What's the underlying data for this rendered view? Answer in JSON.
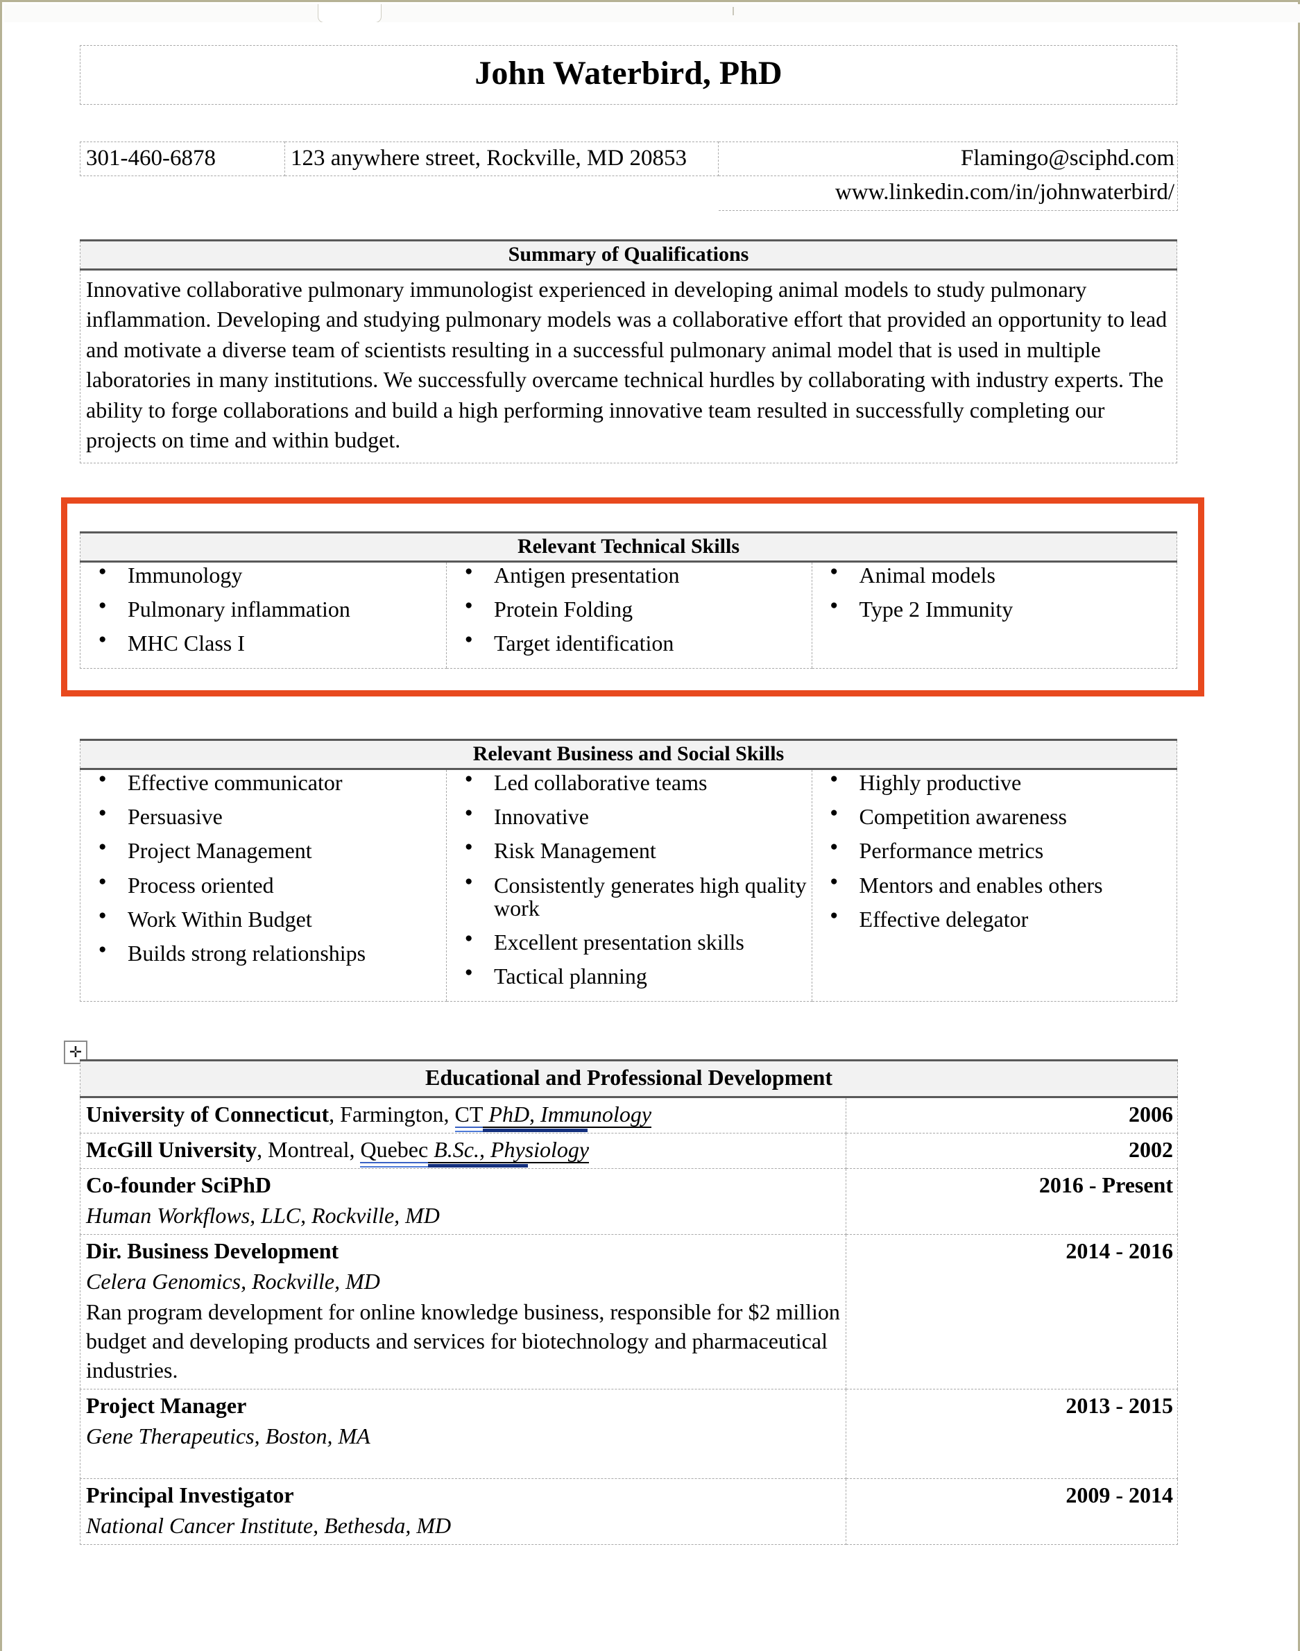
{
  "document": {
    "name": "John Waterbird, PhD"
  },
  "contact": {
    "phone": "301-460-6878",
    "address": "123 anywhere street, Rockville, MD 20853",
    "email": "Flamingo@sciphd.com",
    "linkedin": "www.linkedin.com/in/johnwaterbird/"
  },
  "summary": {
    "heading": "Summary of Qualifications",
    "text": "Innovative collaborative pulmonary immunologist experienced in developing animal models to study pulmonary inflammation. Developing and studying pulmonary models was a collaborative effort that provided an opportunity to lead and motivate a diverse team of scientists resulting in a successful pulmonary animal model that is used in multiple laboratories in many institutions. We successfully overcame technical hurdles by collaborating with industry experts. The ability to forge collaborations and build a high performing innovative team resulted in successfully completing our projects on time and within budget."
  },
  "technical_skills": {
    "heading": "Relevant Technical Skills",
    "columns": [
      [
        "Immunology",
        "Pulmonary inflammation",
        "MHC Class I"
      ],
      [
        "Antigen presentation",
        "Protein Folding",
        "Target identification"
      ],
      [
        "Animal models",
        "Type 2 Immunity"
      ]
    ]
  },
  "business_skills": {
    "heading": "Relevant Business and Social Skills",
    "columns": [
      [
        "Effective communicator",
        "Persuasive",
        "Project Management",
        "Process oriented",
        "Work Within Budget",
        "Builds strong relationships"
      ],
      [
        "Led collaborative teams",
        "Innovative",
        "Risk Management",
        "Consistently generates high quality work",
        "Excellent presentation skills",
        "Tactical planning"
      ],
      [
        "Highly productive",
        "Competition awareness",
        "Performance metrics",
        "Mentors and enables others",
        "Effective delegator"
      ]
    ]
  },
  "education": {
    "heading": "Educational and Professional Development",
    "rows": [
      {
        "org": "University of Connecticut",
        "location": ", Farmington, ",
        "place_flagged": "CT",
        "degree": "PhD, Immunology",
        "date": "2006",
        "subtitle": "",
        "description": ""
      },
      {
        "org": "McGill University",
        "location": ", Montreal, ",
        "place_flagged": "Quebec",
        "degree": "B.Sc., Physiology",
        "date": "2002",
        "subtitle": "",
        "description": ""
      },
      {
        "org": "Co-founder SciPhD",
        "location": "",
        "place_flagged": "",
        "degree": "",
        "date": "2016 - Present",
        "subtitle": "Human Workflows, LLC, Rockville, MD",
        "description": ""
      },
      {
        "org": "Dir. Business Development",
        "location": "",
        "place_flagged": "",
        "degree": "",
        "date": "2014 - 2016",
        "subtitle": "Celera Genomics, Rockville, MD",
        "description": "Ran program development for online knowledge business, responsible for $2 million budget and developing products and services for biotechnology and pharmaceutical industries."
      },
      {
        "org": "Project Manager",
        "location": "",
        "place_flagged": "",
        "degree": "",
        "date": "2013 - 2015",
        "subtitle": "Gene Therapeutics, Boston, MA",
        "description": ""
      },
      {
        "org": "Principal Investigator",
        "location": "",
        "place_flagged": "",
        "degree": "",
        "date": "2009 - 2014",
        "subtitle": "National Cancer Institute, Bethesda, MD",
        "description": ""
      }
    ]
  },
  "annotation": {
    "highlight_color": "#e8491e",
    "highlight_target": "Relevant Technical Skills"
  },
  "icons": {
    "table_move_handle": "✛"
  }
}
